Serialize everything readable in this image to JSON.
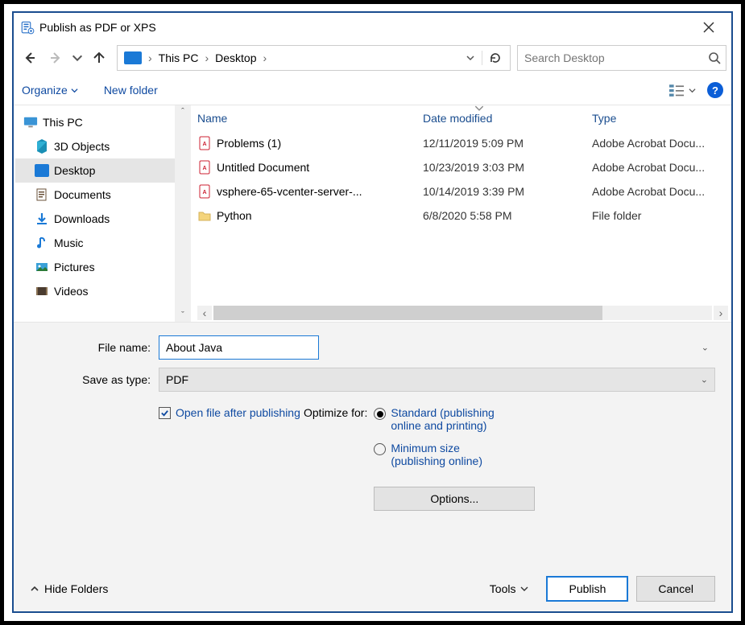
{
  "title": "Publish as PDF or XPS",
  "breadcrumb": {
    "root": "This PC",
    "current": "Desktop"
  },
  "search": {
    "placeholder": "Search Desktop"
  },
  "toolbar": {
    "organize": "Organize",
    "newfolder": "New folder"
  },
  "tree": {
    "parent": "This PC",
    "items": [
      "3D Objects",
      "Desktop",
      "Documents",
      "Downloads",
      "Music",
      "Pictures",
      "Videos"
    ],
    "selected": "Desktop"
  },
  "columns": {
    "name": "Name",
    "date": "Date modified",
    "type": "Type"
  },
  "files": [
    {
      "icon": "pdf",
      "name": "Problems (1)",
      "date": "12/11/2019 5:09 PM",
      "type": "Adobe Acrobat Docu..."
    },
    {
      "icon": "pdf",
      "name": "Untitled Document",
      "date": "10/23/2019 3:03 PM",
      "type": "Adobe Acrobat Docu..."
    },
    {
      "icon": "pdf",
      "name": "vsphere-65-vcenter-server-...",
      "date": "10/14/2019 3:39 PM",
      "type": "Adobe Acrobat Docu..."
    },
    {
      "icon": "folder",
      "name": "Python",
      "date": "6/8/2020 5:58 PM",
      "type": "File folder"
    }
  ],
  "form": {
    "filename_label": "File name:",
    "filename_value": "About Java",
    "savetype_label": "Save as type:",
    "savetype_value": "PDF",
    "open_after": "Open file after publishing",
    "optimize_label": "Optimize for:",
    "radio_standard_1": "Standard (publishing",
    "radio_standard_2": "online and printing)",
    "radio_min_1": "Minimum size",
    "radio_min_2": "(publishing online)",
    "options_btn": "Options...",
    "open_after_checked": true,
    "radio_selected": "standard"
  },
  "footer": {
    "hide": "Hide Folders",
    "tools": "Tools",
    "publish": "Publish",
    "cancel": "Cancel"
  }
}
